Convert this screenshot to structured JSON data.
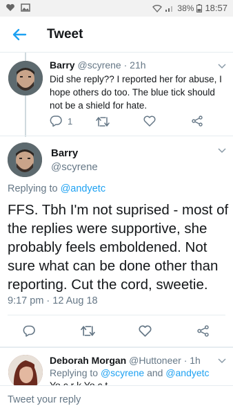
{
  "status_bar": {
    "battery": "38%",
    "time": "18:57"
  },
  "header": {
    "title": "Tweet"
  },
  "tweet1": {
    "name": "Barry",
    "handle": "@scyrene",
    "time": "· 21h",
    "text": "Did she reply?? I reported her for abuse, I hope others do too. The blue tick should not be a shield for hate.",
    "reply_count": "1"
  },
  "tweet2": {
    "name": "Barry",
    "handle": "@scyrene",
    "replying_prefix": "Replying to",
    "replying_to": "@andyetc",
    "text": "FFS. Tbh I'm not suprised - most of the replies were supportive, she probably feels emboldened. Not sure what can be done other than reporting. Cut the cord, sweetie.",
    "timestamp": "9:17 pm · 12 Aug 18"
  },
  "tweet3": {
    "name": "Deborah Morgan",
    "handle": "@Huttoneer",
    "time": "· 1h",
    "replying_prefix": "Replying to",
    "replying_to_1": "@scyrene",
    "replying_and": "and",
    "replying_to_2": "@andyetc",
    "text_partial": "Yo  c    r     k   Yo    c     t"
  },
  "compose": {
    "placeholder": "Tweet your reply"
  },
  "colors": {
    "accent": "#1da1f2",
    "muted": "#657786",
    "divider": "#e6ecf0"
  }
}
